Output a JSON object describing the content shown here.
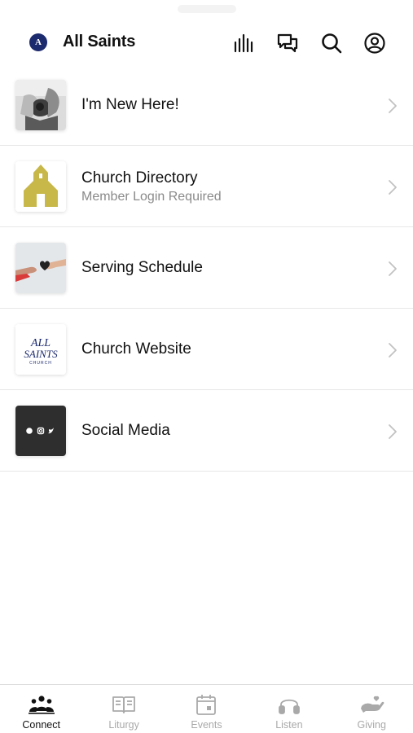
{
  "header": {
    "logo_letter": "A",
    "title": "All Saints",
    "icons": [
      "equalizer-icon",
      "chat-icon",
      "search-icon",
      "profile-icon"
    ]
  },
  "menu": [
    {
      "title": "I'm New Here!",
      "subtitle": "",
      "thumb": "hands-photo"
    },
    {
      "title": "Church Directory",
      "subtitle": "Member Login Required",
      "thumb": "church-building-icon"
    },
    {
      "title": "Serving Schedule",
      "subtitle": "",
      "thumb": "heart-hands-photo"
    },
    {
      "title": "Church Website",
      "subtitle": "",
      "thumb": "all-saints-logo"
    },
    {
      "title": "Social Media",
      "subtitle": "",
      "thumb": "social-icons"
    }
  ],
  "thumb_logo": {
    "line1": "ALL",
    "line2": "SAINTS",
    "line3": "CHURCH"
  },
  "tabs": [
    {
      "label": "Connect",
      "icon": "people-icon",
      "active": true
    },
    {
      "label": "Liturgy",
      "icon": "book-icon",
      "active": false
    },
    {
      "label": "Events",
      "icon": "calendar-icon",
      "active": false
    },
    {
      "label": "Listen",
      "icon": "headphones-icon",
      "active": false
    },
    {
      "label": "Giving",
      "icon": "giving-hand-icon",
      "active": false
    }
  ],
  "colors": {
    "accent": "#1c2a6e",
    "church_gold": "#c8b84a",
    "inactive_tab": "#a9a9a9"
  }
}
